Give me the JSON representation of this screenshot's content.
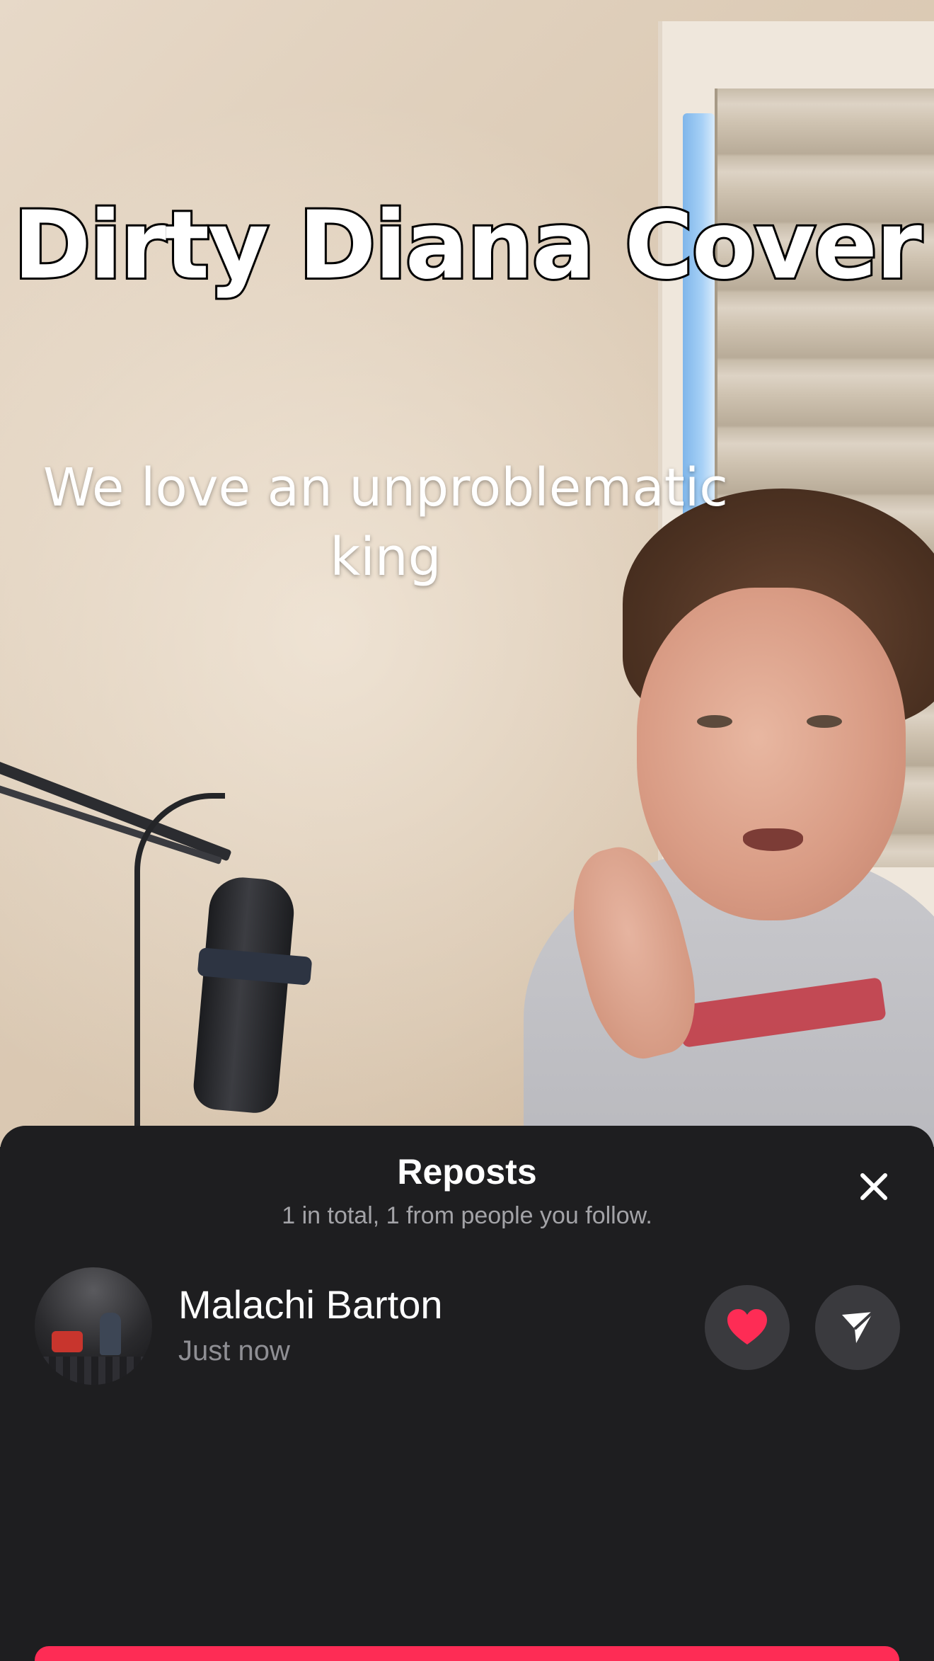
{
  "video": {
    "caption_title": "Dirty Diana Cover",
    "caption_line1": "We love an unproblematic",
    "caption_line2": "king"
  },
  "reposts_sheet": {
    "title": "Reposts",
    "subtitle": "1 in total, 1 from people you follow.",
    "close_icon": "close-icon",
    "items": [
      {
        "name": "Malachi Barton",
        "time": "Just now",
        "like_icon": "heart-icon",
        "share_icon": "send-icon"
      }
    ]
  },
  "colors": {
    "sheet_bg": "#1e1e20",
    "accent": "#fe2c55",
    "heart": "#fe2c55",
    "circle_button_bg": "#3a3a3e",
    "subtitle_text": "#a3a3a7"
  }
}
